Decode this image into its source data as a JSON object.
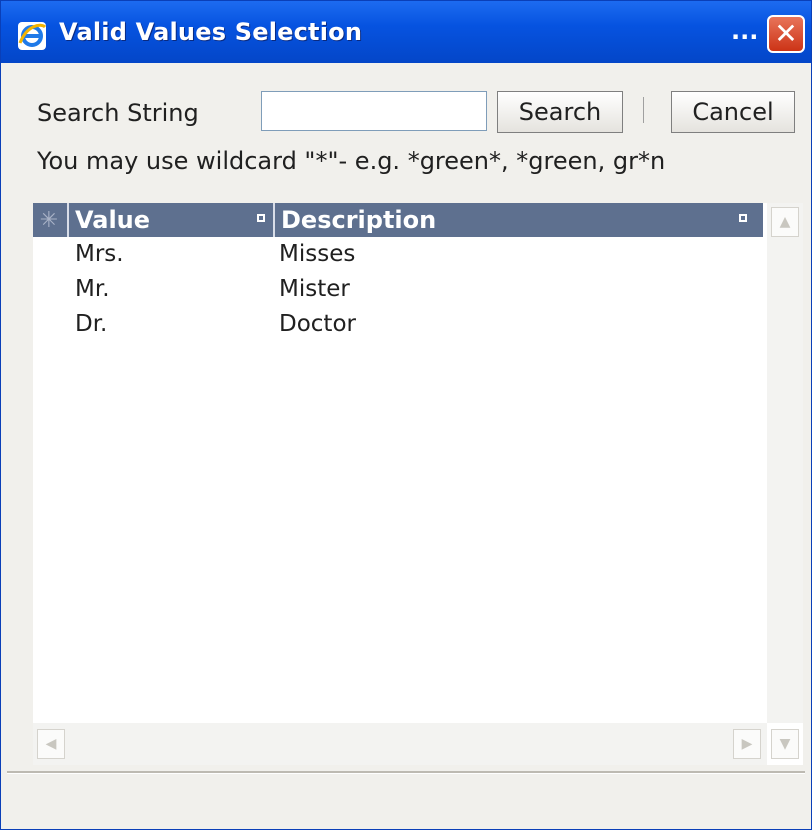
{
  "window": {
    "title": "Valid Values Selection",
    "title_ellipsis": "...",
    "close_glyph": "✕"
  },
  "search": {
    "label": "Search String",
    "value": "",
    "placeholder": "",
    "button_label": "Search",
    "cancel_label": "Cancel",
    "hint": "You may use wildcard \"*\"- e.g. *green*, *green, gr*n"
  },
  "table": {
    "select_all_glyph": "✳",
    "columns": [
      "Value",
      "Description"
    ],
    "rows": [
      {
        "value": "Mrs.",
        "description": "Misses"
      },
      {
        "value": "Mr.",
        "description": "Mister"
      },
      {
        "value": "Dr.",
        "description": "Doctor"
      }
    ]
  },
  "scrollbars": {
    "up_glyph": "▲",
    "down_glyph": "▼",
    "left_glyph": "◀",
    "right_glyph": "▶"
  },
  "colors": {
    "titlebar": "#0653e0",
    "header": "#5e708f",
    "close": "#cc3316"
  }
}
